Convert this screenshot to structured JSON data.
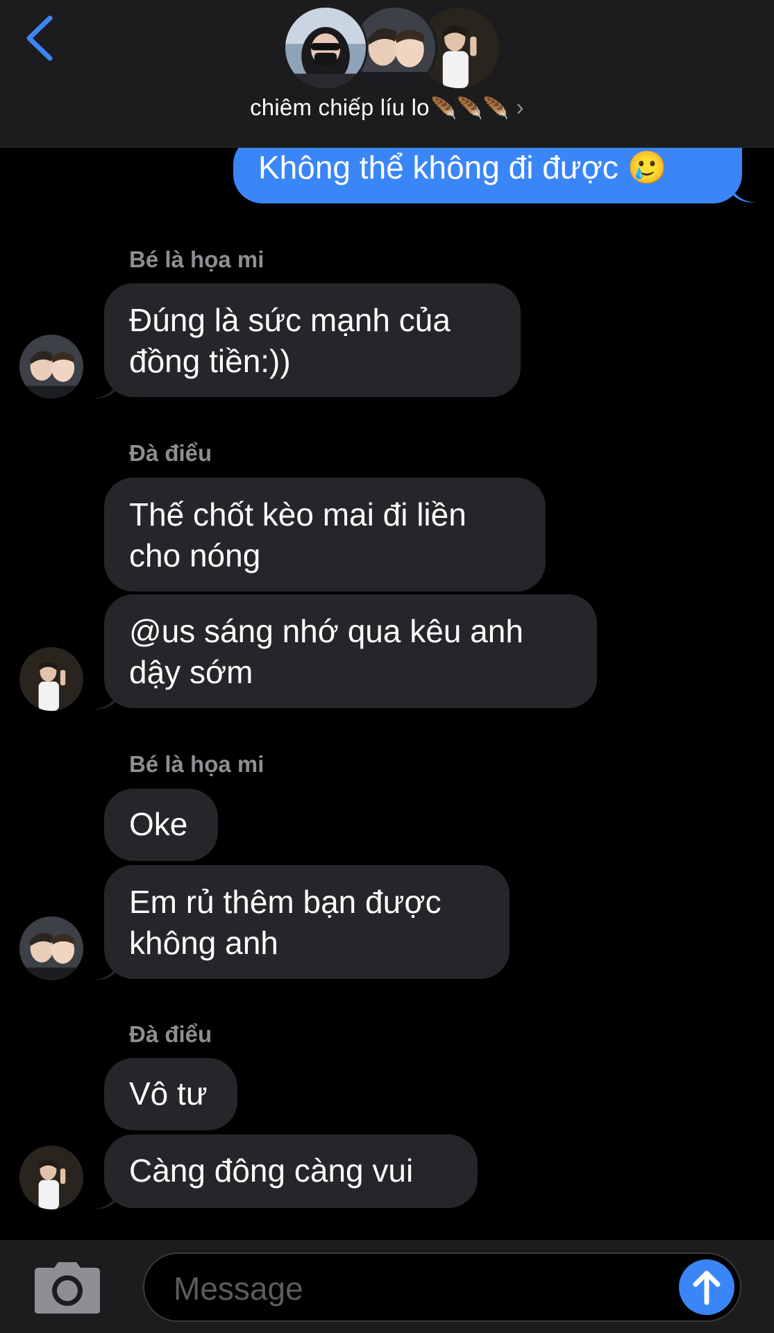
{
  "header": {
    "title": "chiêm chiếp líu lo",
    "title_decoration": "🪶🪶🪶",
    "chevron": "›",
    "back_icon": "chevron-left-icon"
  },
  "messages": [
    {
      "id": "m1",
      "from": "me",
      "lines": [
        "Không thể không đi được 🥲"
      ]
    },
    {
      "id": "m2",
      "from": "other",
      "sender": "Bé là họa mi",
      "lines": [
        "Đúng là sức mạnh của",
        "đồng tiền:))"
      ]
    },
    {
      "id": "m3",
      "from": "other",
      "sender": "Đà điểu",
      "lines": [
        "Thế chốt kèo mai đi liền",
        "cho nóng"
      ]
    },
    {
      "id": "m4",
      "from": "other",
      "lines": [
        "@us sáng nhớ qua kêu anh",
        "dậy sớm"
      ]
    },
    {
      "id": "m5",
      "from": "other",
      "sender": "Bé là họa mi",
      "lines": [
        "Oke"
      ]
    },
    {
      "id": "m6",
      "from": "other",
      "lines": [
        "Em rủ thêm bạn được",
        "không anh"
      ]
    },
    {
      "id": "m7",
      "from": "other",
      "sender": "Đà điểu",
      "lines": [
        "Vô tư"
      ]
    },
    {
      "id": "m8",
      "from": "other",
      "lines": [
        "Càng đông càng vui"
      ]
    }
  ],
  "composer": {
    "placeholder": "Message",
    "camera_icon": "camera-icon",
    "send_icon": "arrow-up-icon"
  },
  "colors": {
    "accent": "#3b86f7",
    "bubble_other": "#26262a",
    "header_bg": "#1c1c1e",
    "sender_label": "#8e8e93"
  }
}
